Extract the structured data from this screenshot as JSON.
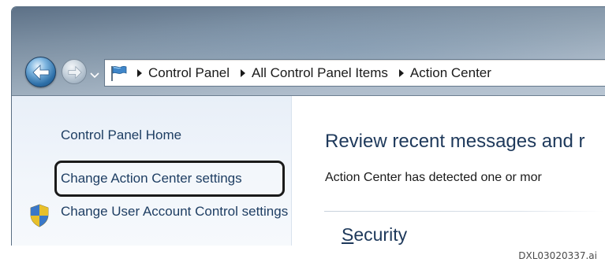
{
  "address_bar": {
    "breadcrumbs": [
      "Control Panel",
      "All Control Panel Items",
      "Action Center"
    ],
    "icon": "control-panel-flag-icon"
  },
  "nav": {
    "back_icon": "back-arrow-icon",
    "forward_icon": "forward-arrow-icon",
    "history_icon": "dropdown-arrow-icon"
  },
  "sidebar": {
    "home_label": "Control Panel Home",
    "settings_label": "Change Action Center settings",
    "uac_label": "Change User Account Control settings",
    "uac_icon": "uac-shield-icon"
  },
  "main": {
    "heading": "Review recent messages and r",
    "description": "Action Center has detected one or mor",
    "section_title_first": "S",
    "section_title_rest": "ecurity"
  },
  "caption": "DXL03020337.ai",
  "colors": {
    "link": "#1e3e63",
    "heading": "#1e395b",
    "highlight_frame": "#1a1a1a"
  }
}
